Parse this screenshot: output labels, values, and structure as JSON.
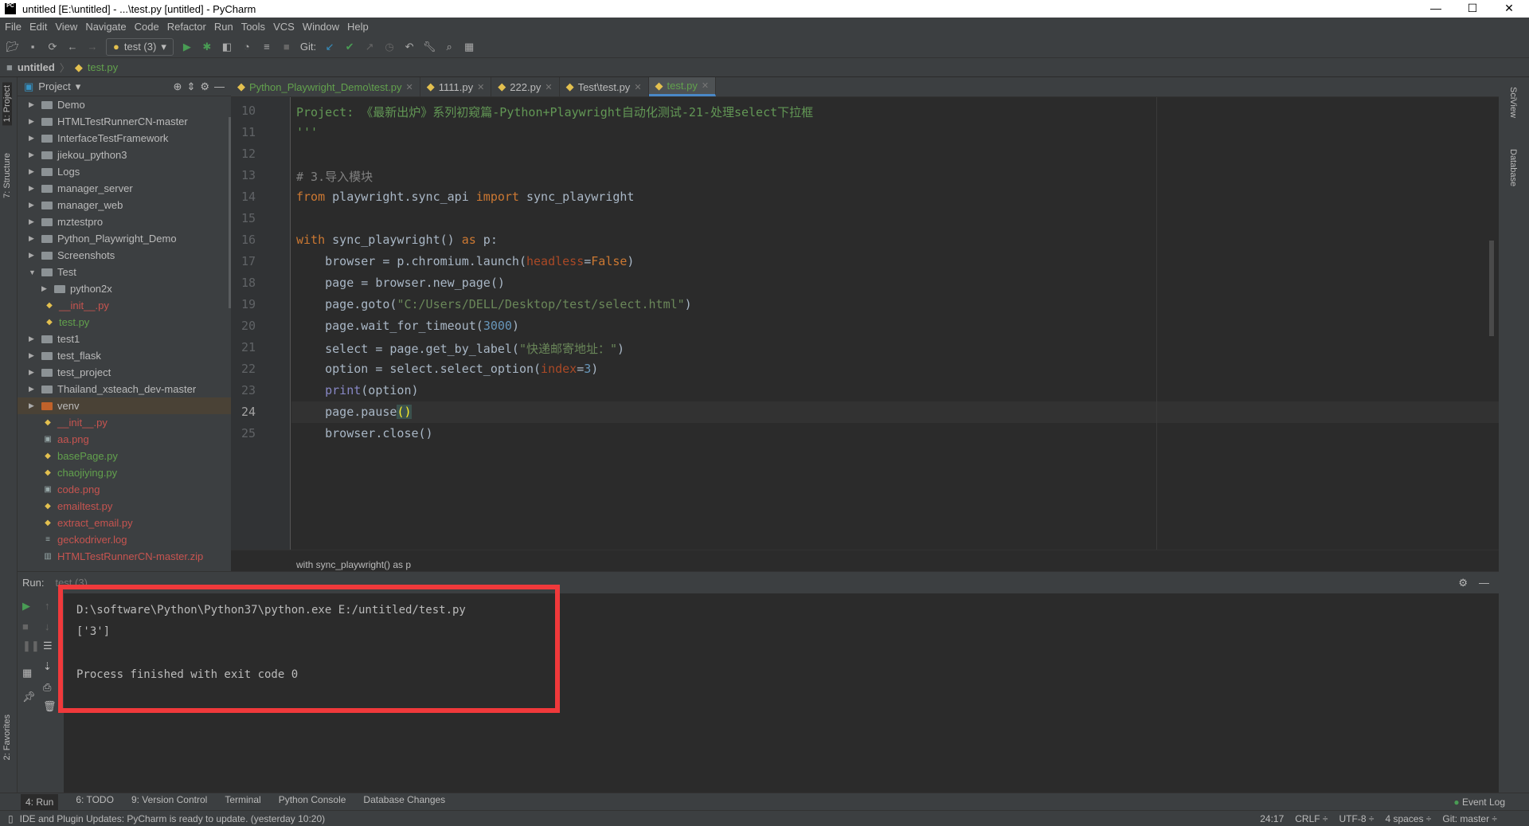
{
  "window": {
    "title": "untitled [E:\\untitled] - ...\\test.py [untitled] - PyCharm",
    "logo": "PC"
  },
  "menu": [
    "File",
    "Edit",
    "View",
    "Navigate",
    "Code",
    "Refactor",
    "Run",
    "Tools",
    "VCS",
    "Window",
    "Help"
  ],
  "toolbar": {
    "run_config": "test (3)",
    "git_label": "Git:"
  },
  "navbar": {
    "project": "untitled",
    "file": "test.py"
  },
  "left_strip": {
    "project": "1: Project",
    "structure": "7: Structure",
    "favorites": "2: Favorites"
  },
  "right_strip": {
    "sciview": "SciView",
    "database": "Database"
  },
  "project_panel": {
    "title": "Project",
    "items": [
      {
        "label": "Demo",
        "type": "folder",
        "depth": 0,
        "color": "#bbbbbb"
      },
      {
        "label": "HTMLTestRunnerCN-master",
        "type": "folder",
        "depth": 0,
        "color": "#bbbbbb"
      },
      {
        "label": "InterfaceTestFramework",
        "type": "folder",
        "depth": 0,
        "color": "#bbbbbb"
      },
      {
        "label": "jiekou_python3",
        "type": "folder",
        "depth": 0,
        "color": "#bbbbbb"
      },
      {
        "label": "Logs",
        "type": "folder",
        "depth": 0,
        "color": "#bbbbbb"
      },
      {
        "label": "manager_server",
        "type": "folder",
        "depth": 0,
        "color": "#bbbbbb"
      },
      {
        "label": "manager_web",
        "type": "folder",
        "depth": 0,
        "color": "#bbbbbb"
      },
      {
        "label": "mztestpro",
        "type": "folder",
        "depth": 0,
        "color": "#bbbbbb"
      },
      {
        "label": "Python_Playwright_Demo",
        "type": "folder",
        "depth": 0,
        "color": "#bbbbbb"
      },
      {
        "label": "Screenshots",
        "type": "folder",
        "depth": 0,
        "color": "#bbbbbb"
      },
      {
        "label": "Test",
        "type": "folder-open",
        "depth": 0,
        "color": "#bbbbbb"
      },
      {
        "label": "python2x",
        "type": "folder",
        "depth": 1,
        "color": "#bbbbbb"
      },
      {
        "label": "__init__.py",
        "type": "py",
        "depth": 1,
        "color": "#c75450"
      },
      {
        "label": "test.py",
        "type": "py",
        "depth": 1,
        "color": "#62a14d"
      },
      {
        "label": "test1",
        "type": "folder",
        "depth": 0,
        "color": "#bbbbbb"
      },
      {
        "label": "test_flask",
        "type": "folder",
        "depth": 0,
        "color": "#bbbbbb"
      },
      {
        "label": "test_project",
        "type": "folder",
        "depth": 0,
        "color": "#bbbbbb"
      },
      {
        "label": "Thailand_xsteach_dev-master",
        "type": "folder",
        "depth": 0,
        "color": "#bbbbbb"
      },
      {
        "label": "venv",
        "type": "venv",
        "depth": 0,
        "color": "#bbbbbb"
      },
      {
        "label": "__init__.py",
        "type": "py",
        "depth": -1,
        "color": "#c75450"
      },
      {
        "label": "aa.png",
        "type": "img",
        "depth": -1,
        "color": "#c75450"
      },
      {
        "label": "basePage.py",
        "type": "py",
        "depth": -1,
        "color": "#62a14d"
      },
      {
        "label": "chaojiying.py",
        "type": "py",
        "depth": -1,
        "color": "#62a14d"
      },
      {
        "label": "code.png",
        "type": "img",
        "depth": -1,
        "color": "#c75450"
      },
      {
        "label": "emailtest.py",
        "type": "py",
        "depth": -1,
        "color": "#c75450"
      },
      {
        "label": "extract_email.py",
        "type": "py",
        "depth": -1,
        "color": "#c75450"
      },
      {
        "label": "geckodriver.log",
        "type": "txt",
        "depth": -1,
        "color": "#c75450"
      },
      {
        "label": "HTMLTestRunnerCN-master.zip",
        "type": "zip",
        "depth": -1,
        "color": "#c75450"
      }
    ]
  },
  "tabs": [
    {
      "label": "Python_Playwright_Demo\\test.py",
      "color": "#62a14d",
      "active": false
    },
    {
      "label": "1111.py",
      "color": "#bbbbbb",
      "active": false
    },
    {
      "label": "222.py",
      "color": "#bbbbbb",
      "active": false
    },
    {
      "label": "Test\\test.py",
      "color": "#bbbbbb",
      "active": false
    },
    {
      "label": "test.py",
      "color": "#62a14d",
      "active": true
    }
  ],
  "editor": {
    "current_line": 24,
    "lines": [
      {
        "n": "10",
        "html": "<span class='doc'>Project: 《最新出炉》系列初窥篇-Python+Playwright自动化测试-21-处理select下拉框</span>"
      },
      {
        "n": "11",
        "html": "<span class='doc'>'''</span>"
      },
      {
        "n": "12",
        "html": ""
      },
      {
        "n": "13",
        "html": "<span class='cm'># 3.导入模块</span>"
      },
      {
        "n": "14",
        "html": "<span class='kw'>from</span> playwright.sync_api <span class='kw'>import</span> sync_playwright"
      },
      {
        "n": "15",
        "html": ""
      },
      {
        "n": "16",
        "html": "<span class='kw'>with</span> sync_playwright() <span class='kw'>as</span> p:"
      },
      {
        "n": "17",
        "html": "    browser = p.chromium.launch(<span class='param'>headless</span>=<span class='kw'>False</span>)"
      },
      {
        "n": "18",
        "html": "    page = browser.new_page()"
      },
      {
        "n": "19",
        "html": "    page.goto(<span class='str'>\"C:/Users/DELL/Desktop/test/select.html\"</span>)"
      },
      {
        "n": "20",
        "html": "    page.wait_for_timeout(<span class='num'>3000</span>)"
      },
      {
        "n": "21",
        "html": "    select = page.get_by_label(<span class='str'>\"快递邮寄地址：\"</span>)"
      },
      {
        "n": "22",
        "html": "    option = select.select_option(<span class='param'>index</span>=<span class='num'>3</span>)"
      },
      {
        "n": "23",
        "html": "    <span class='bi'>print</span>(option)"
      },
      {
        "n": "24",
        "html": "    page.pause<span style='color:#ffef28;background:#3b514d'>()</span>"
      },
      {
        "n": "25",
        "html": "    browser.close()"
      }
    ],
    "breadcrumb": "with sync_playwright() as p"
  },
  "run": {
    "label": "Run:",
    "tab": "test (3)",
    "output": [
      "D:\\software\\Python\\Python37\\python.exe E:/untitled/test.py",
      "['3']",
      "",
      "Process finished with exit code 0"
    ],
    "highlight_color": "#f0393b"
  },
  "tool_windows": [
    "4: Run",
    "6: TODO",
    "9: Version Control",
    "Terminal",
    "Python Console",
    "Database Changes"
  ],
  "event_log": "Event Log",
  "status": {
    "message": "IDE and Plugin Updates: PyCharm is ready to update. (yesterday 10:20)",
    "position": "24:17",
    "line_sep": "CRLF ÷",
    "encoding": "UTF-8 ÷",
    "indent": "4 spaces ÷",
    "git": "Git: master ÷"
  }
}
